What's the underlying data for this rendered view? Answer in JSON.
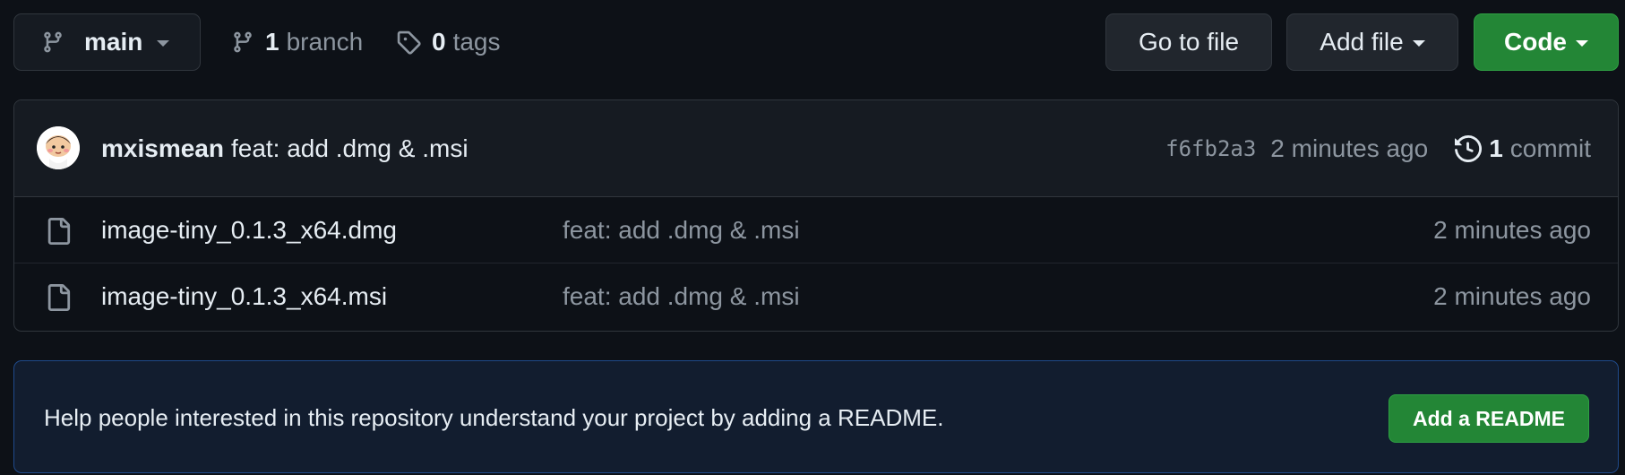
{
  "toolbar": {
    "branch_button_label": "main",
    "branches_count": "1",
    "branches_label": "branch",
    "tags_count": "0",
    "tags_label": "tags",
    "go_to_file_label": "Go to file",
    "add_file_label": "Add file",
    "code_label": "Code"
  },
  "latest_commit": {
    "author": "mxismean",
    "message": "feat: add .dmg & .msi",
    "sha": "f6fb2a3",
    "age": "2 minutes ago",
    "commits_count": "1",
    "commits_label": "commit"
  },
  "files": [
    {
      "name": "image-tiny_0.1.3_x64.dmg",
      "message": "feat: add .dmg & .msi",
      "age": "2 minutes ago",
      "icon": "file-icon"
    },
    {
      "name": "image-tiny_0.1.3_x64.msi",
      "message": "feat: add .dmg & .msi",
      "age": "2 minutes ago",
      "icon": "file-icon"
    }
  ],
  "readme_banner": {
    "text": "Help people interested in this repository understand your project by adding a README.",
    "button_label": "Add a README"
  },
  "colors": {
    "background": "#0d1117",
    "accent_green": "#238636",
    "muted_text": "#8d96a0",
    "border": "#30363d",
    "banner_background": "#121d2f",
    "banner_border": "#1f4a8a"
  }
}
